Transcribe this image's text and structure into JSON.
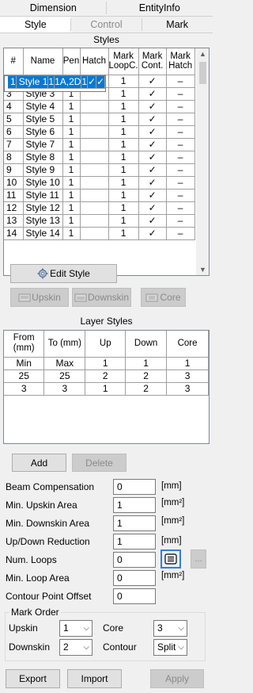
{
  "tabs_row1": [
    "Dimension",
    "EntityInfo"
  ],
  "tabs_row2": [
    {
      "label": "Style",
      "state": "active"
    },
    {
      "label": "Control",
      "state": "disabled"
    },
    {
      "label": "Mark",
      "state": "normal"
    }
  ],
  "styles": {
    "title": "Styles",
    "columns": [
      "#",
      "Name",
      "Pen",
      "Hatch",
      "Mark LoopC.",
      "Mark Cont.",
      "Mark Hatch"
    ],
    "rows": [
      [
        "1",
        "Style 1",
        "1",
        "1A,2D",
        "1",
        "✓",
        "✓"
      ],
      [
        "2",
        "Style 2",
        "1",
        "",
        "1",
        "✓",
        "–"
      ],
      [
        "3",
        "Style 3",
        "1",
        "",
        "1",
        "✓",
        "–"
      ],
      [
        "4",
        "Style 4",
        "1",
        "",
        "1",
        "✓",
        "–"
      ],
      [
        "5",
        "Style 5",
        "1",
        "",
        "1",
        "✓",
        "–"
      ],
      [
        "6",
        "Style 6",
        "1",
        "",
        "1",
        "✓",
        "–"
      ],
      [
        "7",
        "Style 7",
        "1",
        "",
        "1",
        "✓",
        "–"
      ],
      [
        "8",
        "Style 8",
        "1",
        "",
        "1",
        "✓",
        "–"
      ],
      [
        "9",
        "Style 9",
        "1",
        "",
        "1",
        "✓",
        "–"
      ],
      [
        "10",
        "Style 10",
        "1",
        "",
        "1",
        "✓",
        "–"
      ],
      [
        "11",
        "Style 11",
        "1",
        "",
        "1",
        "✓",
        "–"
      ],
      [
        "12",
        "Style 12",
        "1",
        "",
        "1",
        "✓",
        "–"
      ],
      [
        "13",
        "Style 13",
        "1",
        "",
        "1",
        "✓",
        "–"
      ],
      [
        "14",
        "Style 14",
        "1",
        "",
        "1",
        "✓",
        "–"
      ]
    ],
    "selected_row": 0,
    "edit_style_label": "Edit Style",
    "upskin_label": "Upskin",
    "downskin_label": "Downskin",
    "core_label": "Core"
  },
  "layer_styles": {
    "title": "Layer Styles",
    "columns": [
      "From (mm)",
      "To (mm)",
      "Up",
      "Down",
      "Core"
    ],
    "rows": [
      [
        "Min",
        "Max",
        "1",
        "1",
        "1"
      ],
      [
        "25",
        "25",
        "2",
        "2",
        "3"
      ],
      [
        "3",
        "3",
        "1",
        "2",
        "3"
      ]
    ],
    "add_label": "Add",
    "delete_label": "Delete"
  },
  "form": {
    "beam_comp": {
      "label": "Beam Compensation",
      "value": "0",
      "unit": "[mm]"
    },
    "min_upskin": {
      "label": "Min. Upskin Area",
      "value": "1",
      "unit": "[mm²]"
    },
    "min_downskin": {
      "label": "Min. Downskin Area",
      "value": "1",
      "unit": "[mm²]"
    },
    "updown_red": {
      "label": "Up/Down Reduction",
      "value": "1",
      "unit": "[mm]"
    },
    "num_loops": {
      "label": "Num. Loops",
      "value": "0",
      "more": "..."
    },
    "min_loop": {
      "label": "Min. Loop Area",
      "value": "0",
      "unit": "[mm²]"
    },
    "contour_offset": {
      "label": "Contour Point Offset",
      "value": "0"
    }
  },
  "mark_order": {
    "title": "Mark Order",
    "upskin": {
      "label": "Upskin",
      "value": "1"
    },
    "core": {
      "label": "Core",
      "value": "3"
    },
    "downskin": {
      "label": "Downskin",
      "value": "2"
    },
    "contour": {
      "label": "Contour",
      "value": "Split"
    }
  },
  "footer": {
    "export_label": "Export",
    "import_label": "Import",
    "apply_label": "Apply"
  },
  "colors": {
    "selection": "#0078d7",
    "panel": "#f0f0f0",
    "disabled_text": "#8a8a8a"
  }
}
